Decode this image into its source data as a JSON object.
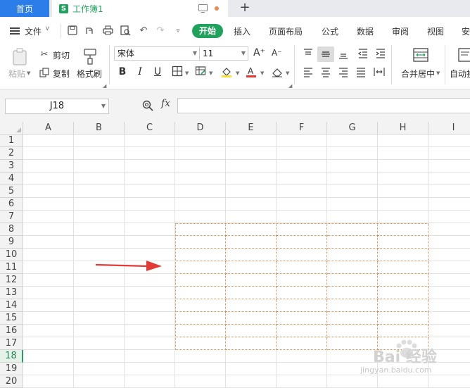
{
  "tabs": {
    "home": "首页",
    "workbook_icon": "S",
    "workbook": "工作簿1",
    "add": "+"
  },
  "menu": {
    "file": "文件",
    "start": "开始",
    "items": [
      "插入",
      "页面布局",
      "公式",
      "数据",
      "审阅",
      "视图",
      "安"
    ]
  },
  "ribbon": {
    "paste": "粘贴",
    "cut": "剪切",
    "copy": "复制",
    "format_painter": "格式刷",
    "font_name": "宋体",
    "font_size": "11",
    "increase_font": "A⁺",
    "decrease_font": "A⁻",
    "bold": "B",
    "italic": "I",
    "underline": "U",
    "merge_center": "合并居中",
    "auto_wrap": "自动换"
  },
  "formula_bar": {
    "cell_ref": "J18",
    "fx": "fx",
    "value": ""
  },
  "sheet": {
    "columns": [
      "A",
      "B",
      "C",
      "D",
      "E",
      "F",
      "G",
      "H",
      "I"
    ],
    "rows": [
      "1",
      "2",
      "3",
      "4",
      "5",
      "6",
      "7",
      "8",
      "9",
      "10",
      "11",
      "12",
      "13",
      "14",
      "15",
      "16",
      "17",
      "18",
      "19",
      "20"
    ],
    "active_row": "18",
    "selection": "D8:H17"
  },
  "annotation": {
    "arrow_color": "#e53935",
    "selection_color": "#e8894b"
  },
  "colors": {
    "accent": "#1fa35c",
    "home_tab": "#2b7de9"
  },
  "watermark": {
    "main": "Bai 经验",
    "sub": "jingyan.baidu.com"
  }
}
